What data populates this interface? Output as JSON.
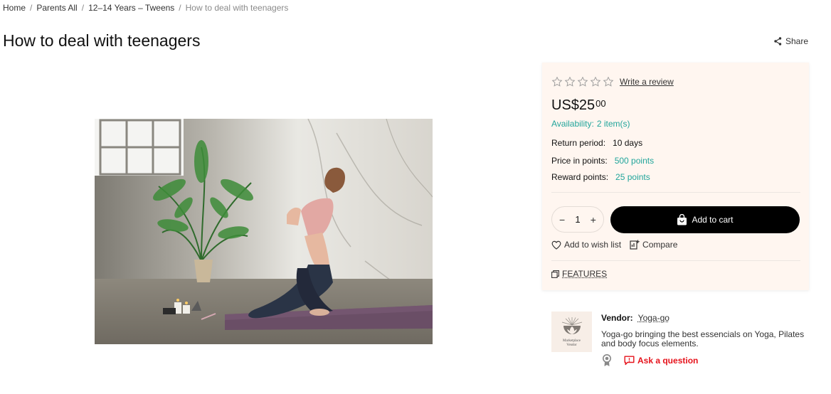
{
  "breadcrumb": {
    "items": [
      "Home",
      "Parents All",
      "12–14 Years – Tweens"
    ],
    "separator": "/",
    "current": "How to deal with teenagers"
  },
  "page_title": "How to deal with teenagers",
  "share_label": "Share",
  "buy_box": {
    "rating": {
      "stars_filled": 0,
      "stars_total": 5,
      "write_review": "Write a review"
    },
    "price": {
      "main": "US$25",
      "cents": "00"
    },
    "availability": {
      "label": "Availability:",
      "value": "2 item(s)"
    },
    "return_period": {
      "label": "Return period:",
      "value": "10 days"
    },
    "price_in_points": {
      "label": "Price in points:",
      "value": "500 points"
    },
    "reward_points": {
      "label": "Reward points:",
      "value": "25 points"
    },
    "quantity": {
      "value": "1",
      "minus": "−",
      "plus": "+"
    },
    "add_to_cart": "Add to cart",
    "add_to_wish_list": "Add to wish list",
    "compare": "Compare",
    "features": "FEATURES"
  },
  "vendor": {
    "label": "Vendor:",
    "name": "Yoga-go",
    "description": "Yoga-go bringing the best essencials on Yoga, Pilates and body focus elements.",
    "logo_caption_1": "Marketplace",
    "logo_caption_2": "Vendor",
    "ask_question": "Ask a question"
  },
  "colors": {
    "accent_teal": "#21a59b",
    "ask_red": "#e6121b",
    "buy_box_bg": "#fff6f0",
    "cart_button": "#000000"
  },
  "icons": [
    "share-icon",
    "star-icon",
    "minus-icon",
    "plus-icon",
    "shopping-bag-icon",
    "heart-icon",
    "compare-icon",
    "features-icon",
    "medal-icon",
    "chat-icon"
  ]
}
